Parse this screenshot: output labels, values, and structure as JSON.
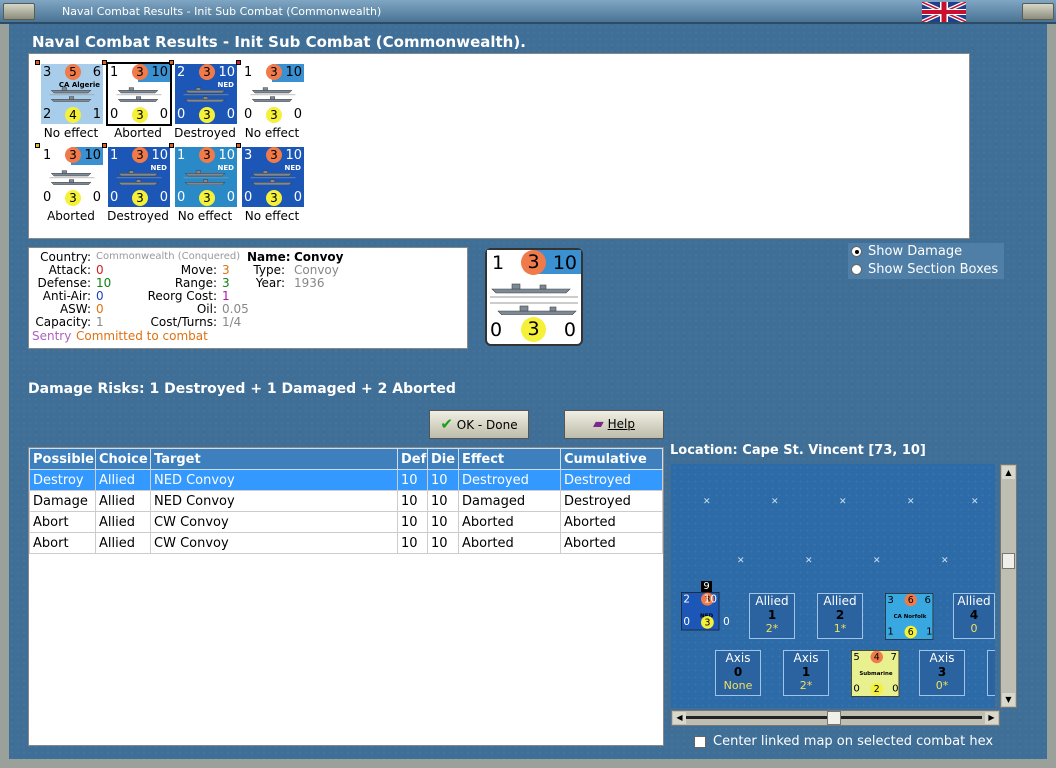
{
  "window": {
    "title": "Naval Combat Results - Init Sub Combat (Commonwealth)"
  },
  "heading": "Naval Combat Results - Init Sub Combat (Commonwealth).",
  "units": [
    {
      "top_left": "3",
      "top_circle": "5",
      "top_right": "6",
      "name": "CA Algerie",
      "bot_left": "2",
      "bot_circle": "4",
      "bot_right": "1",
      "label": "No effect",
      "style": "light",
      "flag": "orange"
    },
    {
      "top_left": "1",
      "top_circle": "3",
      "top_right": "10",
      "name": "",
      "bot_left": "0",
      "bot_circle": "3",
      "bot_right": "0",
      "label": "Aborted",
      "style": "white",
      "flag": "orange"
    },
    {
      "top_left": "2",
      "top_circle": "3",
      "top_right": "10",
      "name": "NED",
      "bot_left": "0",
      "bot_circle": "3",
      "bot_right": "0",
      "label": "Destroyed",
      "style": "dark",
      "flag": "orange"
    },
    {
      "top_left": "1",
      "top_circle": "3",
      "top_right": "10",
      "name": "",
      "bot_left": "0",
      "bot_circle": "3",
      "bot_right": "0",
      "label": "No effect",
      "style": "white",
      "flag": "red"
    },
    {
      "top_left": "1",
      "top_circle": "3",
      "top_right": "10",
      "name": "",
      "bot_left": "0",
      "bot_circle": "3",
      "bot_right": "0",
      "label": "Aborted",
      "style": "white",
      "flag": "yellow"
    },
    {
      "top_left": "1",
      "top_circle": "3",
      "top_right": "10",
      "name": "NED",
      "bot_left": "0",
      "bot_circle": "3",
      "bot_right": "0",
      "label": "Destroyed",
      "style": "dark",
      "flag": "orange"
    },
    {
      "top_left": "1",
      "top_circle": "3",
      "top_right": "10",
      "name": "NED",
      "bot_left": "0",
      "bot_circle": "3",
      "bot_right": "0",
      "label": "No effect",
      "style": "mid",
      "flag": "orange"
    },
    {
      "top_left": "3",
      "top_circle": "3",
      "top_right": "10",
      "name": "NED",
      "bot_left": "0",
      "bot_circle": "3",
      "bot_right": "0",
      "label": "No effect",
      "style": "dark",
      "flag": "orange"
    }
  ],
  "info": {
    "country_label": "Country:",
    "country_value": "Commonwealth (Conquered)",
    "attack_label": "Attack:",
    "attack_value": "0",
    "defense_label": "Defense:",
    "defense_value": "10",
    "antiair_label": "Anti-Air:",
    "antiair_value": "0",
    "asw_label": "ASW:",
    "asw_value": "0",
    "capacity_label": "Capacity:",
    "capacity_value": "1",
    "sentry": "Sentry",
    "committed": "Committed to combat",
    "move_label": "Move:",
    "move_value": "3",
    "range_label": "Range:",
    "range_value": "3",
    "reorg_label": "Reorg Cost:",
    "reorg_value": "1",
    "oil_label": "Oil:",
    "oil_value": "0.05",
    "costturns_label": "Cost/Turns:",
    "costturns_value": "1/4",
    "name_label": "Name:",
    "name_value": "Convoy",
    "type_label": "Type:",
    "type_value": "Convoy",
    "year_label": "Year:",
    "year_value": "1936"
  },
  "big_counter": {
    "top_left": "1",
    "top_circle": "3",
    "top_right": "10",
    "bot_left": "0",
    "bot_circle": "3",
    "bot_right": "0"
  },
  "options": {
    "show_damage": "Show Damage",
    "show_sections": "Show Section Boxes"
  },
  "damage_risks": "Damage Risks:  1 Destroyed + 1 Damaged + 2 Aborted",
  "buttons": {
    "ok": "OK - Done",
    "help": "Help"
  },
  "table": {
    "headers": [
      "Possible",
      "Choice",
      "Target",
      "Def",
      "Die",
      "Effect",
      "Cumulative"
    ],
    "rows": [
      [
        "Destroy",
        "Allied",
        "NED Convoy",
        "10",
        "10",
        "Destroyed",
        "Destroyed"
      ],
      [
        "Damage",
        "Allied",
        "NED Convoy",
        "10",
        "10",
        "Damaged",
        "Destroyed"
      ],
      [
        "Abort",
        "Allied",
        "CW Convoy",
        "10",
        "10",
        "Aborted",
        "Aborted"
      ],
      [
        "Abort",
        "Allied",
        "CW Convoy",
        "10",
        "10",
        "Aborted",
        "Aborted"
      ]
    ]
  },
  "location": "Location:  Cape St. Vincent [73, 10]",
  "map": {
    "stack_count": "9",
    "allied_boxes": [
      {
        "title": "Allied",
        "num": "1",
        "sub": "2*"
      },
      {
        "title": "Allied",
        "num": "2",
        "sub": "1*"
      },
      {
        "title": "Allied",
        "num": "4",
        "sub": "0"
      }
    ],
    "axis_boxes": [
      {
        "title": "Axis",
        "num": "0",
        "sub": "None"
      },
      {
        "title": "Axis",
        "num": "1",
        "sub": "2*"
      },
      {
        "title": "Axis",
        "num": "3",
        "sub": "0*"
      }
    ],
    "norfolk": {
      "tl": "3",
      "tc": "6",
      "tr": "6",
      "name": "CA Norfolk",
      "bl": "1",
      "bc": "6",
      "br": "1"
    },
    "sub": {
      "tl": "5",
      "tc": "4",
      "tr": "7",
      "name": "Submarine",
      "bl": "0",
      "bc": "2",
      "br": "0"
    },
    "ned": {
      "tl": "2",
      "tc": "3",
      "tr": "10",
      "name": "NED",
      "bl": "0",
      "bc": "3",
      "br": "0"
    }
  },
  "center_map_label": "Center linked map on selected combat hex"
}
